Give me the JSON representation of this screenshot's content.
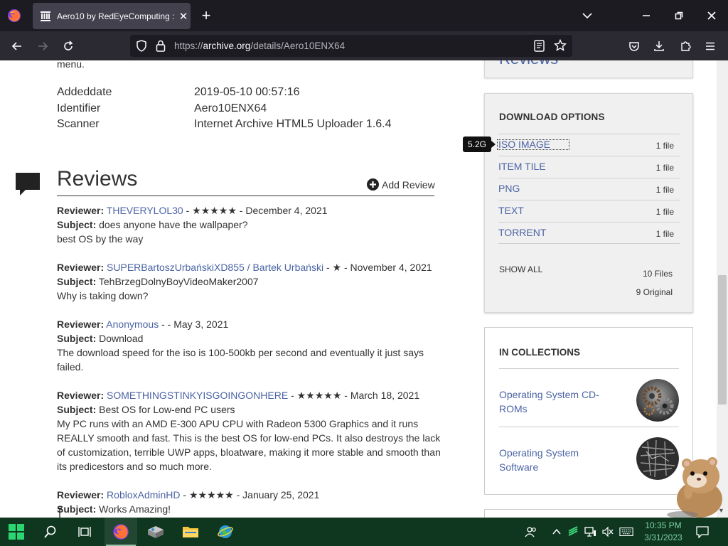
{
  "browser": {
    "tab_title": "Aero10 by RedEyeComputing : I",
    "tab_close": "✕",
    "new_tab": "+",
    "url_prefix": "https://",
    "url_host": "archive.org",
    "url_path": "/details/Aero10ENX64"
  },
  "page": {
    "top_fragment": "menu.",
    "top_box_text": "Reviews",
    "metadata": [
      {
        "key": "Addeddate",
        "value": "2019-05-10 00:57:16"
      },
      {
        "key": "Identifier",
        "value": "Aero10ENX64"
      },
      {
        "key": "Scanner",
        "value": "Internet Archive HTML5 Uploader 1.6.4"
      }
    ],
    "reviews_heading": "Reviews",
    "add_review_label": "Add Review",
    "reviews": [
      {
        "label_reviewer": "Reviewer:",
        "name": "THEVERYLOL30",
        "meta": " - ★★★★★ - December 4, 2021",
        "label_subject": "Subject:",
        "subject": " does anyone have the wallpaper?",
        "body": "best OS by the way"
      },
      {
        "label_reviewer": "Reviewer:",
        "name": "SUPERBartoszUrbańskiXD855 / Bartek Urbański",
        "meta": " - ★ - November 4, 2021",
        "label_subject": "Subject:",
        "subject": " TehBrzegDolnyBoyVideoMaker2007",
        "body": "Why is taking down?"
      },
      {
        "label_reviewer": "Reviewer:",
        "name": "Anonymous",
        "meta": " - - May 3, 2021",
        "label_subject": "Subject:",
        "subject": " Download",
        "body": "The download speed for the iso is 100-500kb per second and eventually it just says failed."
      },
      {
        "label_reviewer": "Reviewer:",
        "name": "SOMETHINGSTINKYISGOINGONHERE",
        "meta": " - ★★★★★ - March 18, 2021",
        "label_subject": "Subject:",
        "subject": " Best OS for Low-end PC users",
        "body": "My PC runs with an AMD E-300 APU CPU with Radeon 5300 Graphics and it runs REALLY smooth and fast. This is the best OS for low-end PCs. It also destroys the lack of customization, terrible UWP apps, bloatware, making it more stable and smooth than its predicestors and so much more."
      },
      {
        "label_reviewer": "Reviewer:",
        "name": "RobloxAdminHD",
        "meta": " - ★★★★★ - January 25, 2021",
        "label_subject": "Subject:",
        "subject": " Works Amazing!",
        "body": ""
      }
    ]
  },
  "sidebar": {
    "download_heading": "DOWNLOAD OPTIONS",
    "downloads": [
      {
        "name": "ISO IMAGE",
        "count": "1 file"
      },
      {
        "name": "ITEM TILE",
        "count": "1 file"
      },
      {
        "name": "PNG",
        "count": "1 file"
      },
      {
        "name": "TEXT",
        "count": "1 file"
      },
      {
        "name": "TORRENT",
        "count": "1 file"
      }
    ],
    "show_all": "SHOW ALL",
    "files_count": "10 Files",
    "original_count": "9 Original",
    "tooltip": "5.2G",
    "collections_heading": "IN COLLECTIONS",
    "collections": [
      {
        "name": "Operating System CD-ROMs"
      },
      {
        "name": "Operating System Software"
      }
    ]
  },
  "taskbar": {
    "time": "10:35 PM",
    "date": "3/31/2023"
  },
  "colors": {
    "link": "#4b64a5",
    "taskbar": "#0f3720",
    "tab_bg": "#42414d",
    "toolbar": "#2b2a33"
  }
}
